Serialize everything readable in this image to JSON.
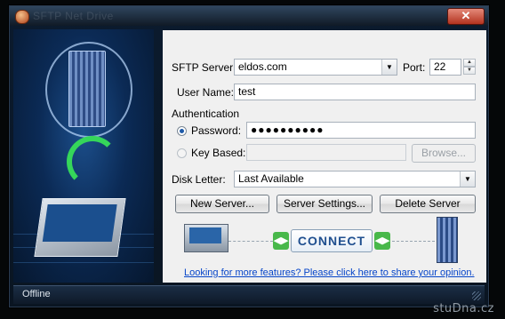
{
  "window": {
    "title": "SFTP Net Drive",
    "close_glyph": "✕"
  },
  "sidebar_art": {
    "icons": [
      "server-icon",
      "globe-icon",
      "sync-arrows-icon",
      "laptop-icon"
    ]
  },
  "form": {
    "server_label": "SFTP Server:",
    "server_value": "eldos.com",
    "port_label": "Port:",
    "port_value": "22",
    "username_label": "User Name:",
    "username_value": "test",
    "auth_heading": "Authentication",
    "password_option": "Password:",
    "password_masked": "●●●●●●●●●●",
    "keybased_option": "Key Based:",
    "keybased_value": "",
    "browse_label": "Browse...",
    "disk_letter_label": "Disk Letter:",
    "disk_letter_value": "Last Available",
    "new_server_label": "New Server...",
    "server_settings_label": "Server Settings...",
    "delete_server_label": "Delete Server",
    "connect_label": "CONNECT",
    "feedback_link": "Looking for more features? Please click here to share your opinion."
  },
  "status": {
    "text": "Offline"
  },
  "watermark": {
    "text": "stuDna.cz"
  },
  "colors": {
    "connect_text": "#1f4f8f",
    "link": "#0645c9",
    "arrow_green": "#48b84a",
    "close": "#c7422b"
  }
}
